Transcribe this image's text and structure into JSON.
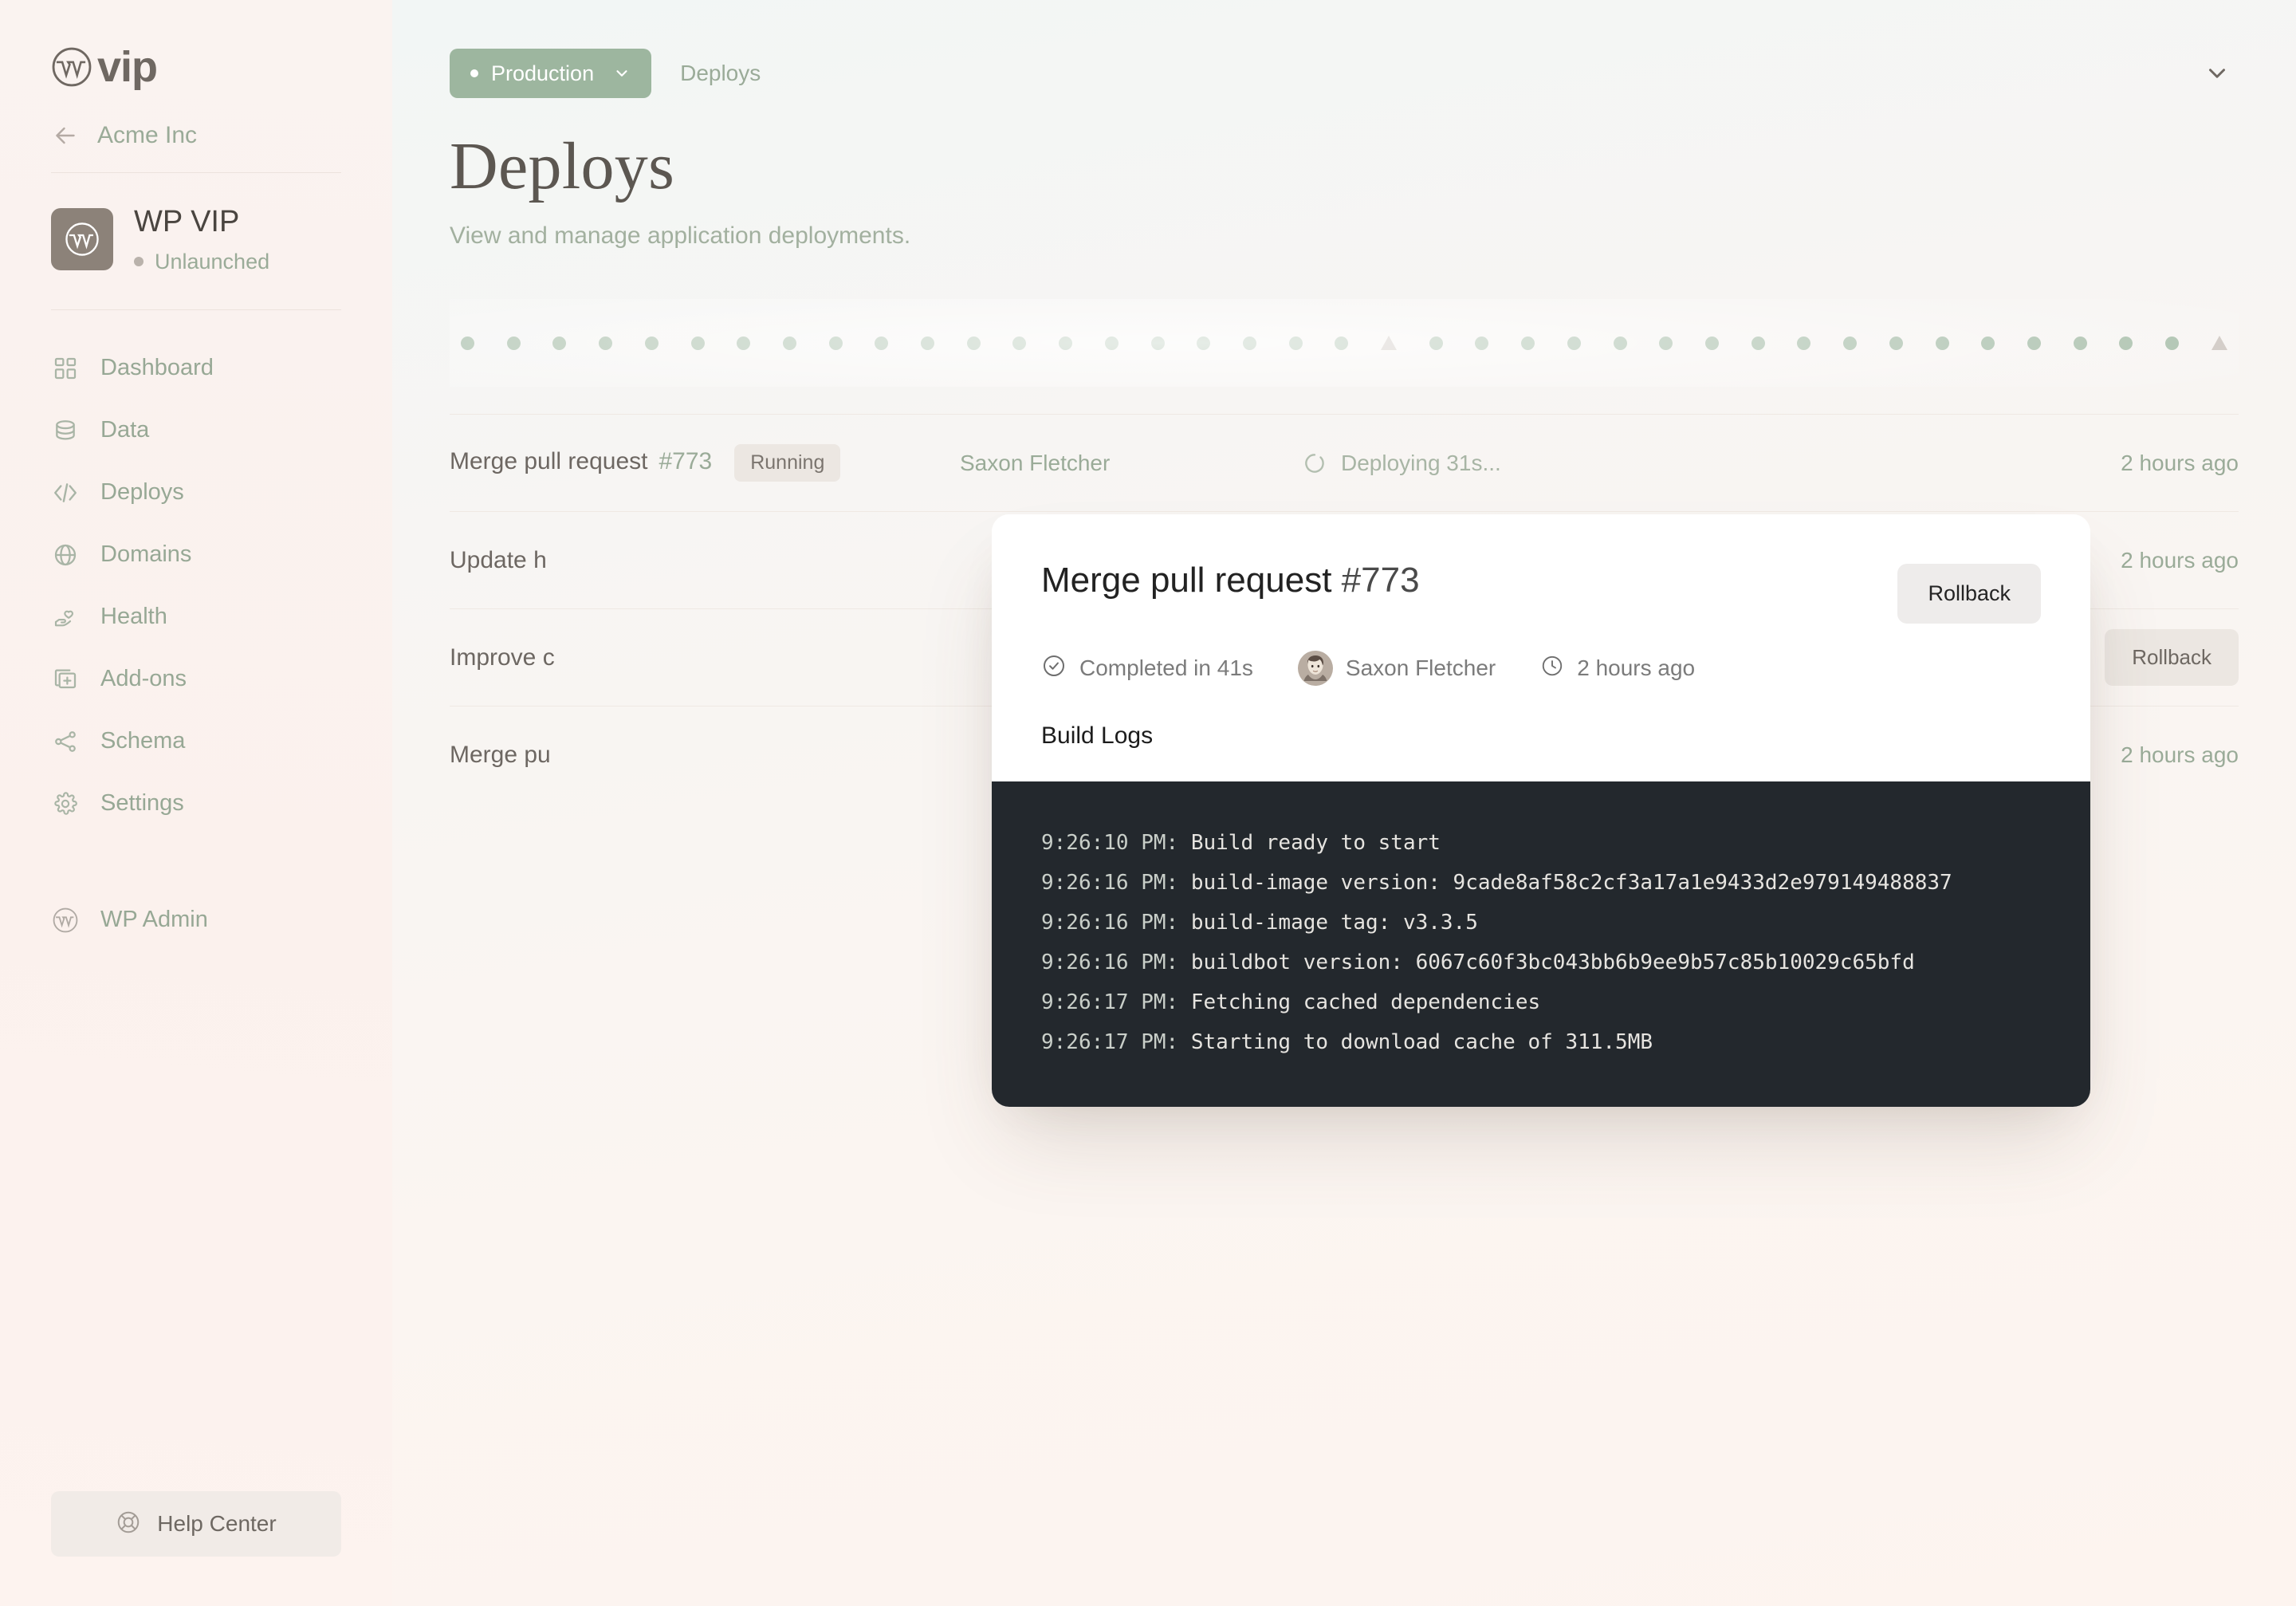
{
  "brand": {
    "logo_word": "vip",
    "logo_icon": "wordpress-icon"
  },
  "sidebar": {
    "back": {
      "label": "Acme Inc",
      "icon": "arrow-left-icon"
    },
    "site": {
      "name": "WP VIP",
      "status": "Unlaunched",
      "avatar_icon": "wordpress-icon"
    },
    "nav": [
      {
        "label": "Dashboard",
        "icon": "grid-icon"
      },
      {
        "label": "Data",
        "icon": "database-icon"
      },
      {
        "label": "Deploys",
        "icon": "code-icon"
      },
      {
        "label": "Domains",
        "icon": "globe-icon"
      },
      {
        "label": "Health",
        "icon": "heart-hand-icon"
      },
      {
        "label": "Add-ons",
        "icon": "plus-square-icon"
      },
      {
        "label": "Schema",
        "icon": "nodes-icon"
      },
      {
        "label": "Settings",
        "icon": "gear-icon"
      }
    ],
    "wp_admin": {
      "label": "WP Admin",
      "icon": "wordpress-icon"
    },
    "help": {
      "label": "Help Center",
      "icon": "lifebuoy-icon"
    }
  },
  "header": {
    "environment": "Production",
    "environment_chevron": "chevron-down-icon",
    "breadcrumb": "Deploys",
    "collapse_chevron": "chevron-down-icon"
  },
  "page": {
    "title": "Deploys",
    "subtitle": "View and manage application deployments."
  },
  "timeline": {
    "markers": [
      "dot",
      "dot",
      "dot",
      "dot",
      "dot",
      "dot",
      "dot",
      "dot",
      "dot",
      "dot",
      "dot",
      "dot",
      "dot",
      "dot",
      "dot",
      "dot",
      "dot",
      "dot",
      "dot",
      "dot",
      "triangle",
      "dot",
      "dot",
      "dot",
      "dot",
      "dot",
      "dot",
      "dot",
      "dot",
      "dot",
      "dot",
      "dot",
      "dot",
      "dot",
      "dot",
      "dot",
      "dot",
      "dot",
      "triangle"
    ],
    "dot_color": "#a9bfab",
    "triangle_color": "#cfc8c2"
  },
  "deploys": [
    {
      "title": "Merge pull request",
      "number": "#773",
      "badge": "Running",
      "author": "Saxon Fletcher",
      "status": "Deploying 31s...",
      "status_icon": "spinner-icon",
      "time": "2 hours ago",
      "action": ""
    },
    {
      "title": "Update h",
      "number": "",
      "badge": "",
      "author": "",
      "status": "",
      "status_icon": "",
      "time": "2 hours ago",
      "action": ""
    },
    {
      "title": "Improve c",
      "number": "",
      "badge": "",
      "author": "",
      "status": "",
      "status_icon": "",
      "time": "",
      "action": "Rollback"
    },
    {
      "title": "Merge pu",
      "number": "",
      "badge": "",
      "author": "",
      "status": "",
      "status_icon": "",
      "time": "2 hours ago",
      "action": ""
    }
  ],
  "modal": {
    "title": "Merge pull request",
    "title_number": "#773",
    "rollback_label": "Rollback",
    "status_icon": "check-circle-icon",
    "status": "Completed in 41s",
    "author": "Saxon Fletcher",
    "author_avatar": "user-avatar",
    "time_icon": "clock-icon",
    "time": "2 hours ago",
    "logs_label": "Build Logs",
    "logs": [
      {
        "ts": "9:26:10 PM:",
        "text": " Build ready to start"
      },
      {
        "ts": "9:26:16 PM:",
        "text": " build-image version: 9cade8af58c2cf3a17a1e9433d2e979149488837"
      },
      {
        "ts": "9:26:16 PM:",
        "text": " build-image tag: v3.3.5"
      },
      {
        "ts": "9:26:16 PM:",
        "text": " buildbot version: 6067c60f3bc043bb6b9ee9b57c85b10029c65bfd"
      },
      {
        "ts": "9:26:17 PM:",
        "text": " Fetching cached dependencies"
      },
      {
        "ts": "9:26:17 PM:",
        "text": " Starting to download cache of 311.5MB"
      }
    ]
  },
  "colors": {
    "accent_green": "#9db69f",
    "muted_green": "#9aab98",
    "terminal_bg": "#23282d",
    "page_bg": "#fbf4f1"
  }
}
